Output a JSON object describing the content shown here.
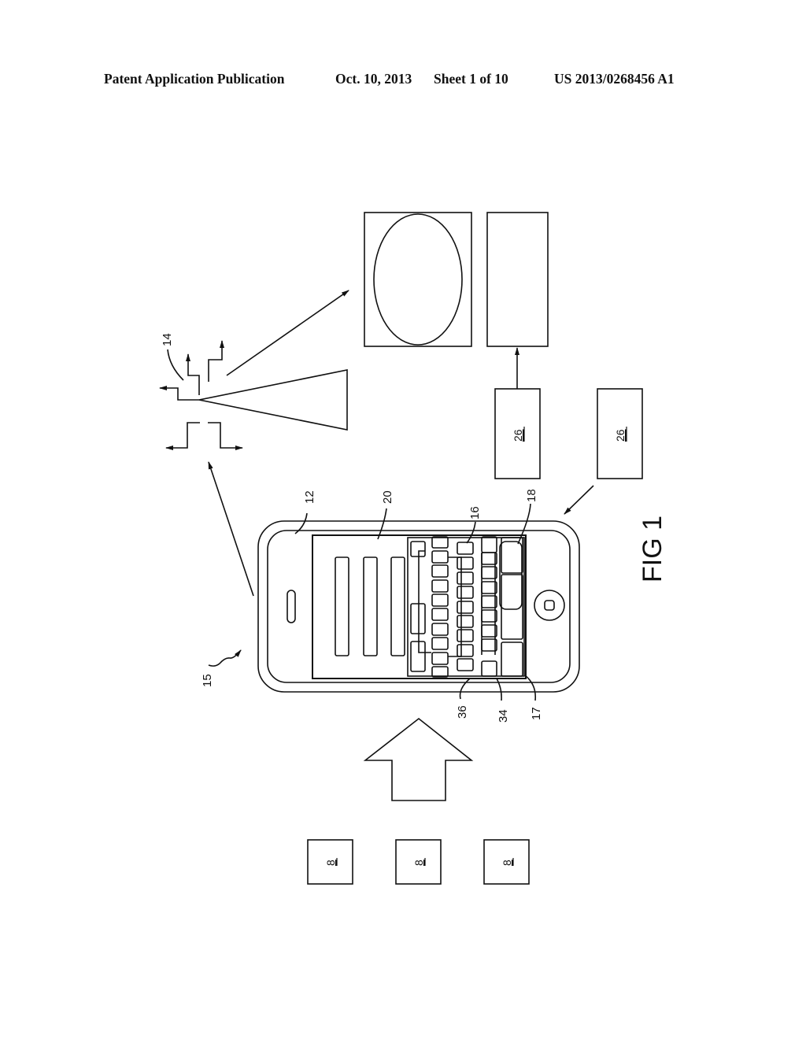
{
  "header": {
    "publication": "Patent Application Publication",
    "date": "Oct. 10, 2013",
    "sheet": "Sheet 1 of 10",
    "number": "US 2013/0268456 A1"
  },
  "figure": {
    "label": "FIG 1",
    "refs": {
      "device": "15",
      "screen": "12",
      "display_area": "20",
      "signal": "14",
      "key": "16",
      "key_group": "18",
      "key_bottom": "17",
      "row_34": "34",
      "row_36": "36",
      "remote_box": "26",
      "remote_box_2": "26",
      "input_a": "8",
      "input_b": "8",
      "input_c": "8"
    }
  },
  "colors": {
    "ink": "#111111",
    "paper": "#ffffff"
  }
}
